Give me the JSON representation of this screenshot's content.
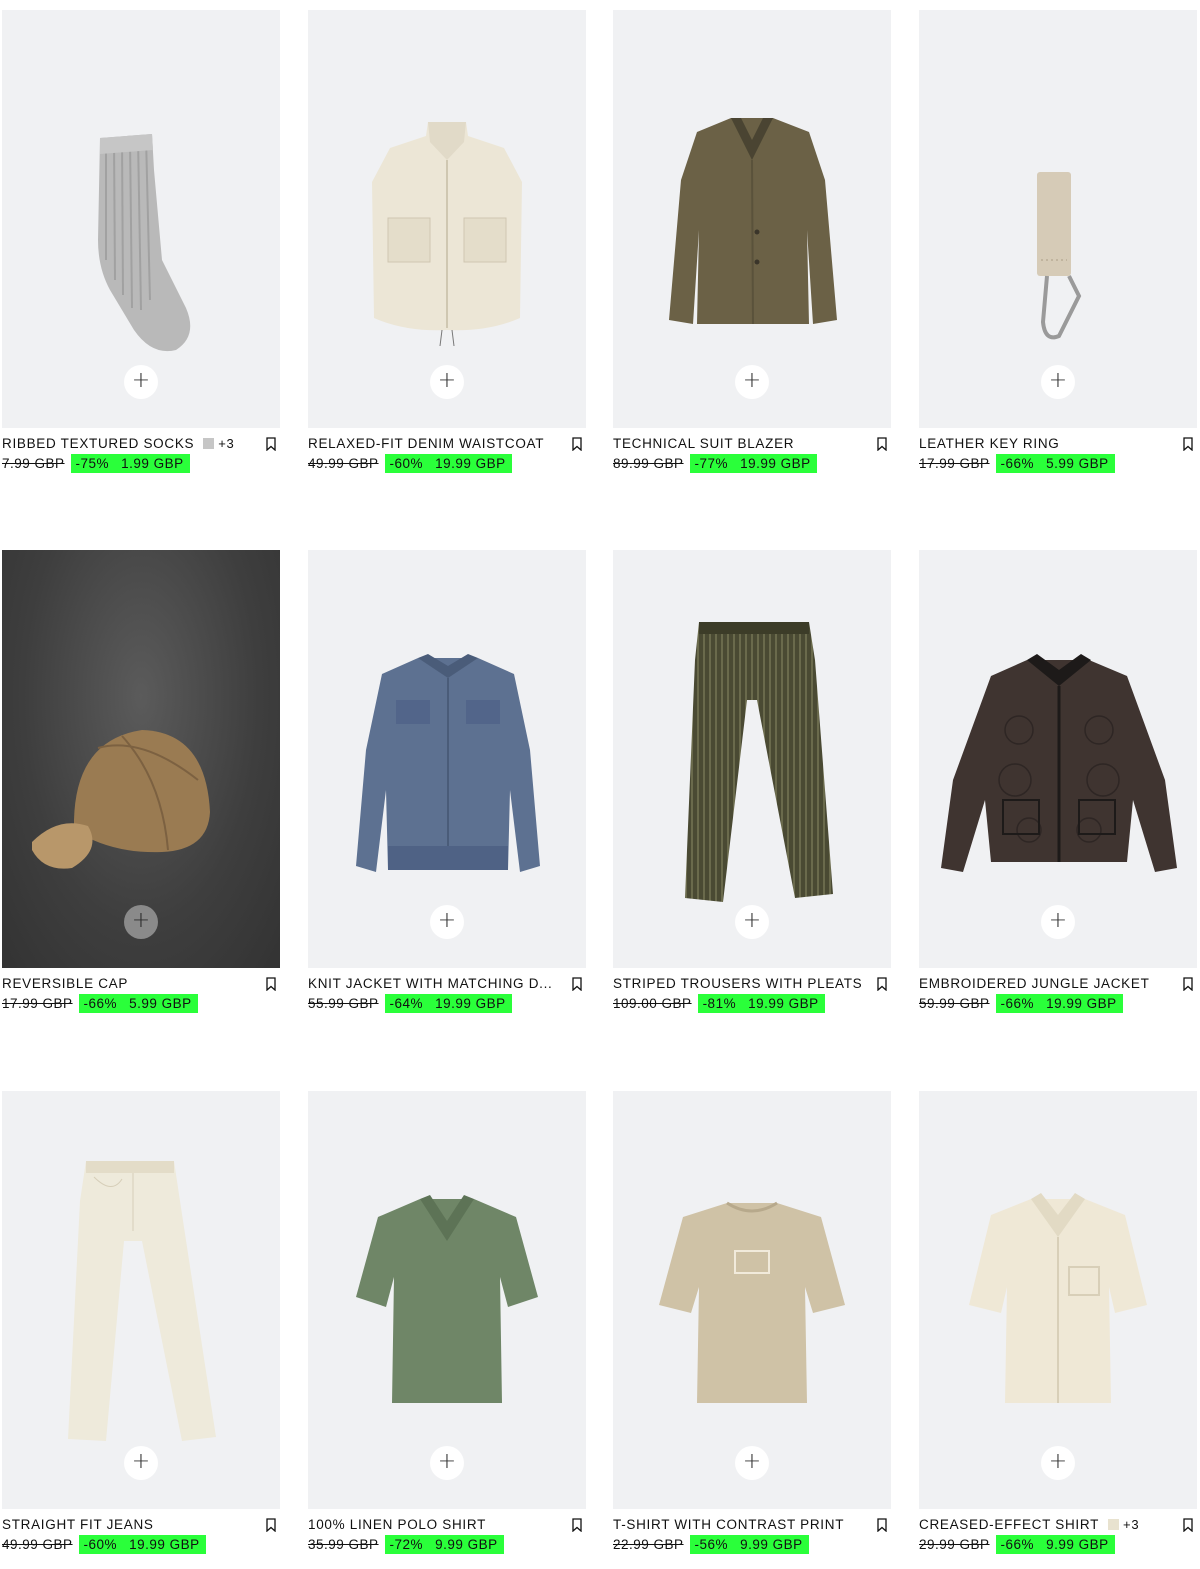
{
  "products": [
    {
      "name": "RIBBED TEXTURED SOCKS",
      "swatch_color": "#c6c6c6",
      "more_colors": "+3",
      "old_price": "7.99 GBP",
      "discount": "-75%",
      "price": "1.99 GBP",
      "image": "socks-icon"
    },
    {
      "name": "RELAXED-FIT DENIM WAISTCOAT",
      "old_price": "49.99 GBP",
      "discount": "-60%",
      "price": "19.99 GBP",
      "image": "waistcoat-icon"
    },
    {
      "name": "TECHNICAL SUIT BLAZER",
      "old_price": "89.99 GBP",
      "discount": "-77%",
      "price": "19.99 GBP",
      "image": "blazer-icon"
    },
    {
      "name": "LEATHER KEY RING",
      "old_price": "17.99 GBP",
      "discount": "-66%",
      "price": "5.99 GBP",
      "image": "key-ring-icon"
    },
    {
      "name": "REVERSIBLE CAP",
      "old_price": "17.99 GBP",
      "discount": "-66%",
      "price": "5.99 GBP",
      "image": "cap-icon"
    },
    {
      "name": "KNIT JACKET WITH MATCHING D...",
      "old_price": "55.99 GBP",
      "discount": "-64%",
      "price": "19.99 GBP",
      "image": "denim-jacket-icon"
    },
    {
      "name": "STRIPED TROUSERS WITH PLEATS",
      "old_price": "109.00 GBP",
      "discount": "-81%",
      "price": "19.99 GBP",
      "image": "trousers-icon"
    },
    {
      "name": "EMBROIDERED JUNGLE JACKET",
      "old_price": "59.99 GBP",
      "discount": "-66%",
      "price": "19.99 GBP",
      "image": "quilted-jacket-icon"
    },
    {
      "name": "STRAIGHT FIT JEANS",
      "old_price": "49.99 GBP",
      "discount": "-60%",
      "price": "19.99 GBP",
      "image": "jeans-icon"
    },
    {
      "name": "100% LINEN POLO SHIRT",
      "old_price": "35.99 GBP",
      "discount": "-72%",
      "price": "9.99 GBP",
      "image": "polo-shirt-icon"
    },
    {
      "name": "T-SHIRT WITH CONTRAST PRINT",
      "old_price": "22.99 GBP",
      "discount": "-56%",
      "price": "9.99 GBP",
      "image": "t-shirt-icon"
    },
    {
      "name": "CREASED-EFFECT SHIRT",
      "swatch_color": "#e8e2cf",
      "more_colors": "+3",
      "old_price": "29.99 GBP",
      "discount": "-66%",
      "price": "9.99 GBP",
      "image": "shirt-icon"
    }
  ],
  "add_button_label": "+",
  "colors": {
    "sale_highlight": "#2aff3a",
    "image_bg": "#f0f1f3"
  }
}
